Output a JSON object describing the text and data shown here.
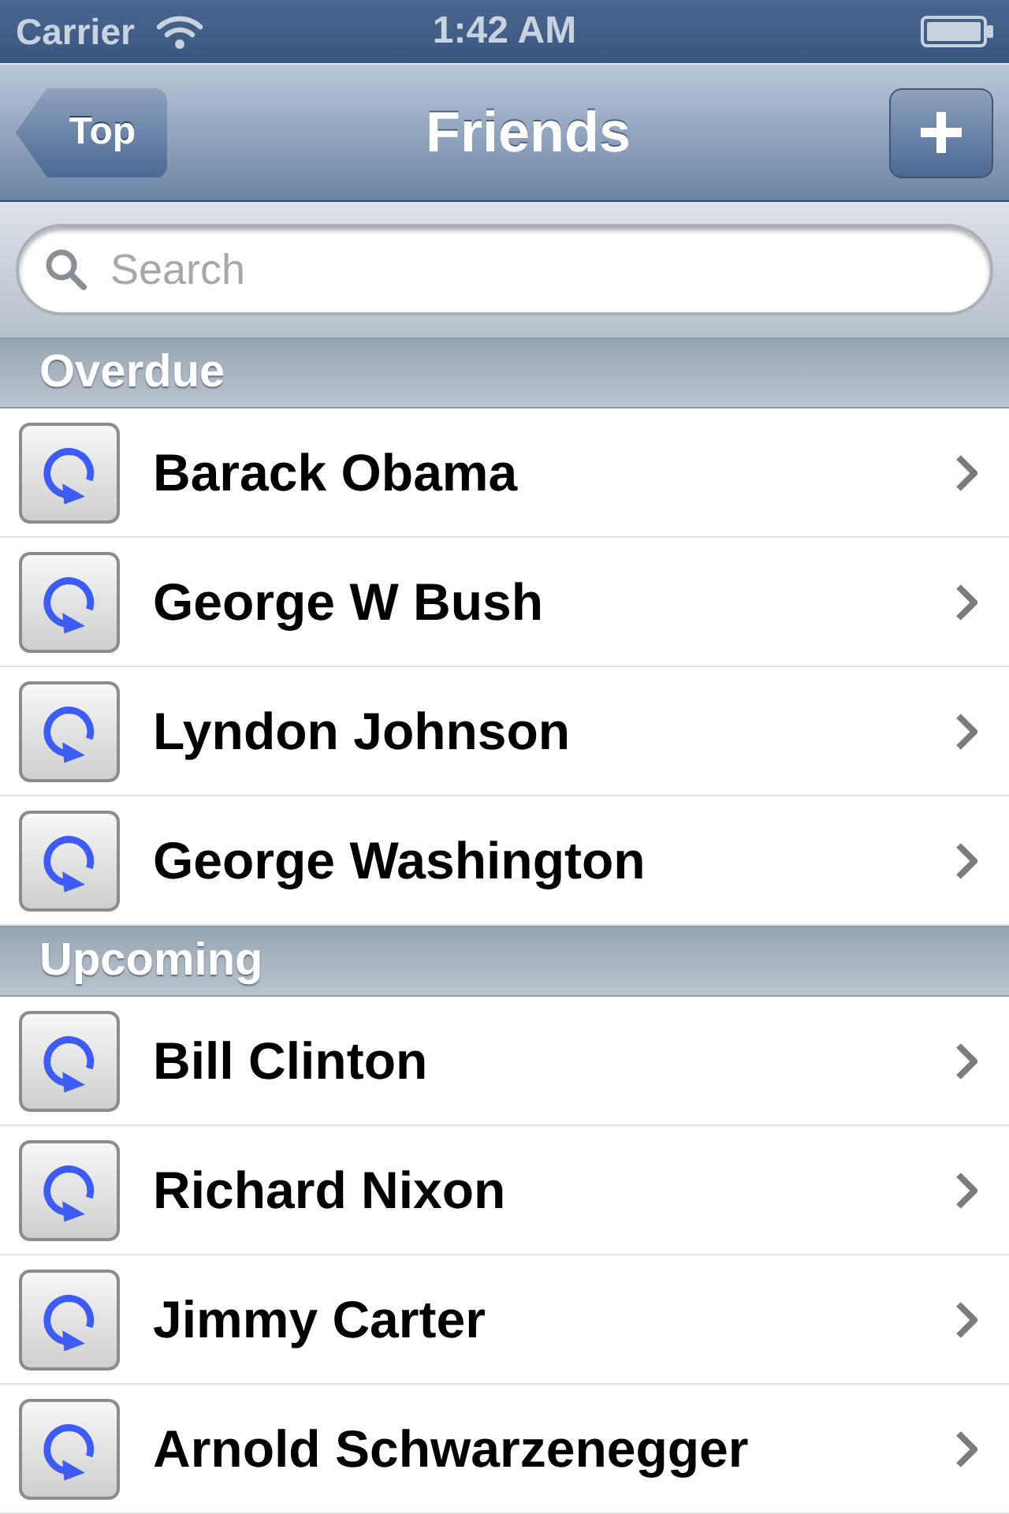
{
  "status_bar": {
    "carrier": "Carrier",
    "time": "1:42 AM"
  },
  "nav_bar": {
    "back_button": "Top",
    "title": "Friends"
  },
  "search": {
    "placeholder": "Search"
  },
  "sections": [
    {
      "title": "Overdue",
      "rows": [
        {
          "name": "Barack Obama"
        },
        {
          "name": "George W Bush"
        },
        {
          "name": "Lyndon Johnson"
        },
        {
          "name": "George Washington"
        }
      ]
    },
    {
      "title": "Upcoming",
      "rows": [
        {
          "name": "Bill Clinton"
        },
        {
          "name": "Richard Nixon"
        },
        {
          "name": "Jimmy Carter"
        },
        {
          "name": "Arnold Schwarzenegger"
        }
      ]
    }
  ]
}
